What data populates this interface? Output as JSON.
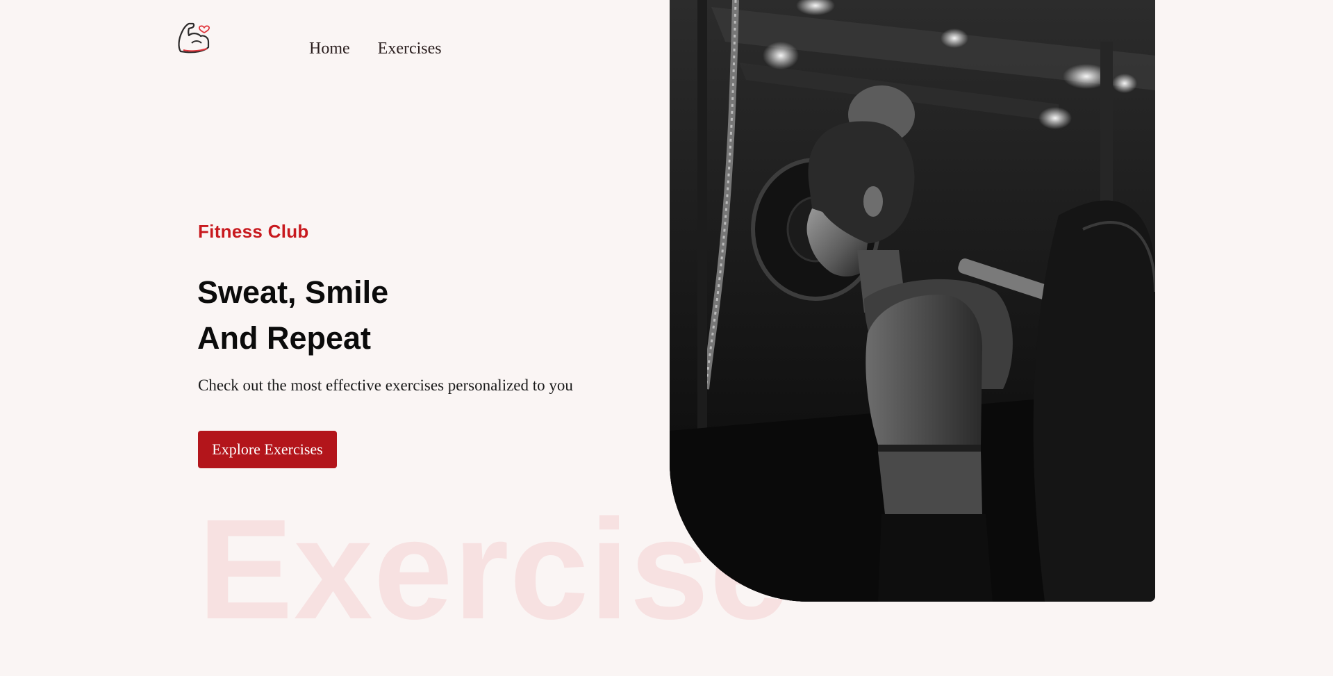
{
  "header": {
    "logo_icon": "flexed-arm-heart-icon",
    "nav": [
      {
        "label": "Home"
      },
      {
        "label": "Exercises"
      }
    ]
  },
  "hero": {
    "eyebrow": "Fitness Club",
    "headline_line1": "Sweat, Smile",
    "headline_line2": "And Repeat",
    "subtext": "Check out the most effective exercises personalized to you",
    "cta_label": "Explore Exercises",
    "watermark": "Exercise",
    "image_alt": "woman-squatting-with-barbell-black-and-white-photo"
  },
  "colors": {
    "background": "#faf5f4",
    "accent": "#c8191e",
    "button": "#b3151b",
    "watermark": "#f7e1e1",
    "text": "#0b0b0b"
  }
}
